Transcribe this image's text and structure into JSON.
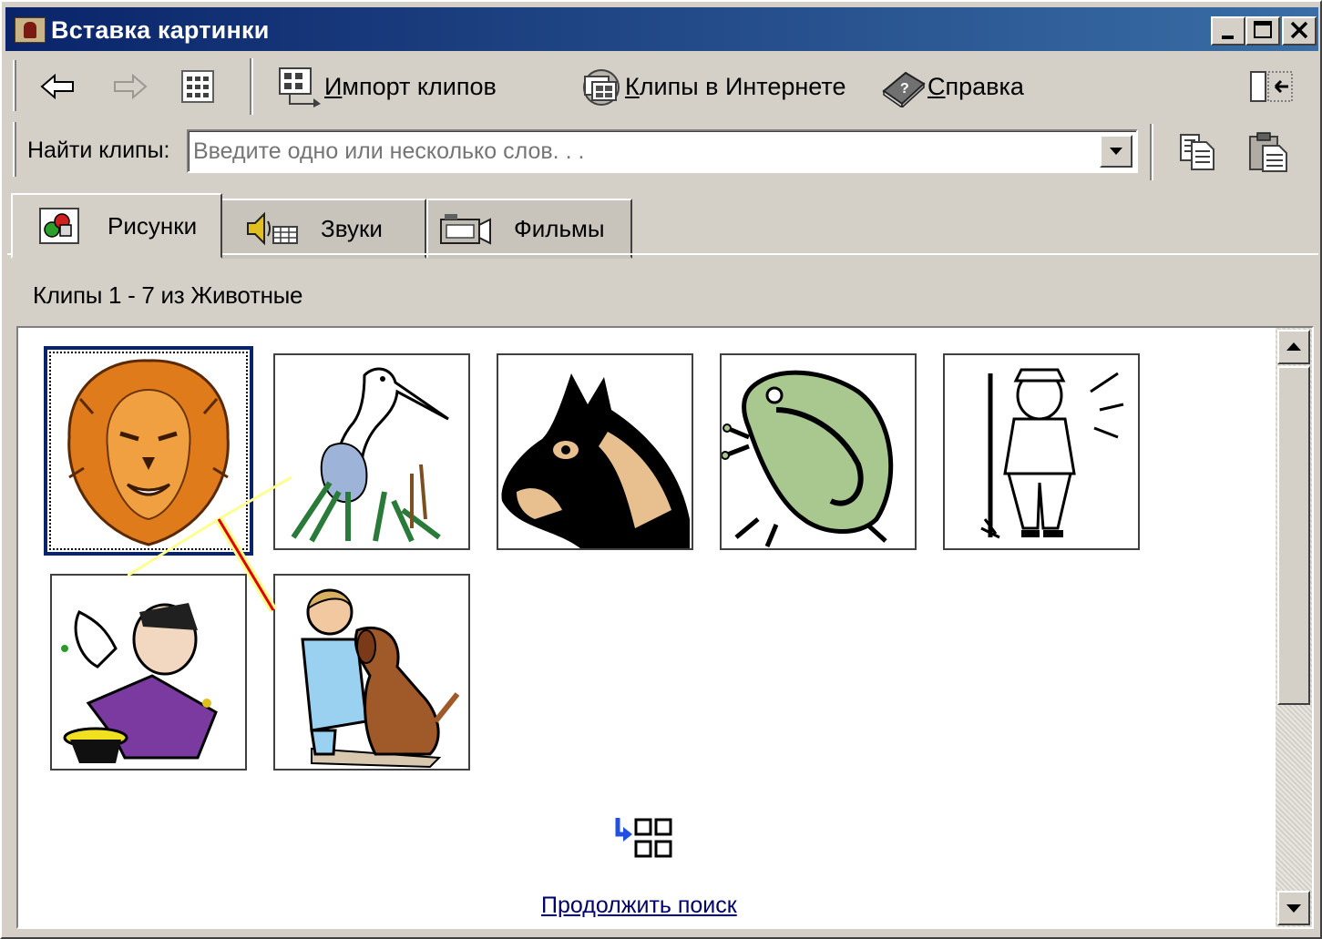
{
  "window": {
    "title": "Вставка картинки",
    "controls": [
      "minimize",
      "maximize",
      "close"
    ]
  },
  "toolbar": {
    "back_icon": "back-arrow-icon",
    "forward_icon": "forward-arrow-icon",
    "view_icon": "grid-view-icon",
    "import_label_u": "И",
    "import_label_rest": "мпорт клипов",
    "online_label_u": "К",
    "online_label_rest": "липы в Интернете",
    "help_label_u": "С",
    "help_label_rest": "правка",
    "changeview_icon": "change-view-icon"
  },
  "search": {
    "label": "Найти клипы:",
    "placeholder": "Введите одно или несколько слов. . .",
    "copy_icon": "copy-icon",
    "paste_icon": "paste-icon"
  },
  "tabs": [
    {
      "label": "Рисунки",
      "icon": "pictures-icon",
      "active": true
    },
    {
      "label": "Звуки",
      "icon": "sounds-icon",
      "active": false
    },
    {
      "label": "Фильмы",
      "icon": "movies-icon",
      "active": false
    }
  ],
  "results": {
    "count_text": "Клипы 1 - 7 из Животные",
    "clips": [
      {
        "name": "lion",
        "selected": true
      },
      {
        "name": "heron",
        "selected": false
      },
      {
        "name": "horse",
        "selected": false
      },
      {
        "name": "frog",
        "selected": false
      },
      {
        "name": "farmer",
        "selected": false
      },
      {
        "name": "magician",
        "selected": false
      },
      {
        "name": "girl-with-dog",
        "selected": false
      }
    ],
    "continue_icon": "continue-search-icon",
    "continue_label": "Продолжить поиск"
  },
  "colors": {
    "titlebar": "#0a246a",
    "face": "#d4d0c8",
    "link": "#00006a"
  }
}
